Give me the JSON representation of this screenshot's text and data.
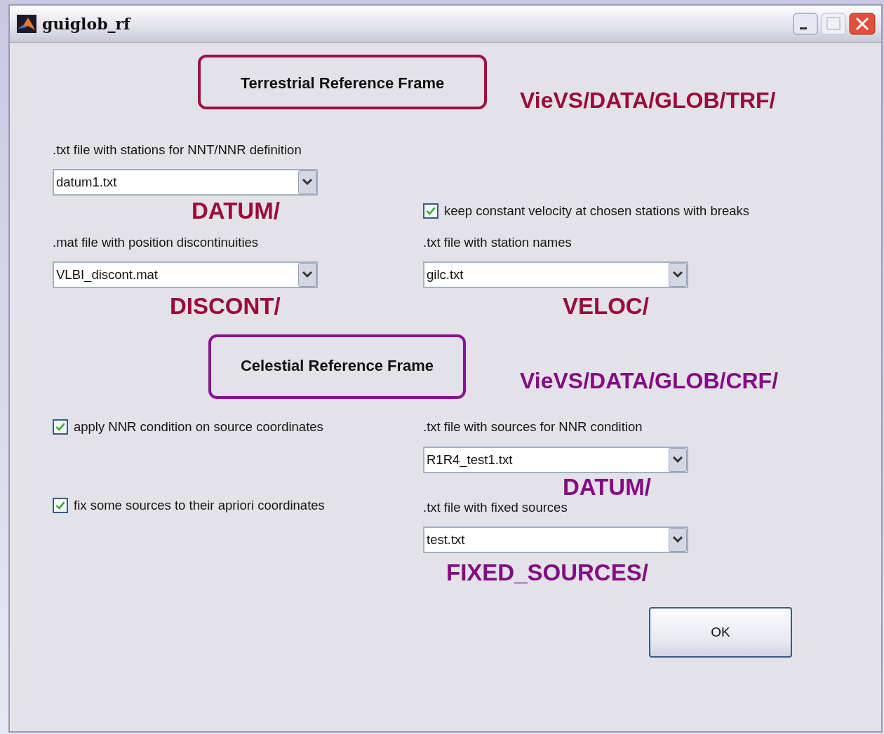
{
  "window": {
    "title": "guiglob_rf"
  },
  "terrestrial": {
    "heading": "Terrestrial Reference Frame",
    "path": "VieVS/DATA/GLOB/TRF/",
    "datum": {
      "label": ".txt file with stations for NNT/NNR definition",
      "value": "datum1.txt",
      "folder": "DATUM/"
    },
    "keep_velocity": {
      "label": "keep constant velocity at chosen stations with breaks",
      "checked": true
    },
    "discont": {
      "label": ".mat file with position discontinuities",
      "value": "VLBI_discont.mat",
      "folder": "DISCONT/"
    },
    "station_names": {
      "label": ".txt file with station names",
      "value": "gilc.txt",
      "folder": "VELOC/"
    }
  },
  "celestial": {
    "heading": "Celestial Reference Frame",
    "path": "VieVS/DATA/GLOB/CRF/",
    "nnr": {
      "label": "apply NNR condition on source coordinates",
      "checked": true
    },
    "fix": {
      "label": "fix some sources to their apriori coordinates",
      "checked": true
    },
    "nnr_sources": {
      "label": ".txt file with sources for NNR condition",
      "value": "R1R4_test1.txt",
      "folder": "DATUM/"
    },
    "fixed_sources": {
      "label": ".txt file with fixed sources",
      "value": "test.txt",
      "folder": "FIXED_SOURCES/"
    }
  },
  "ok_button": "OK"
}
